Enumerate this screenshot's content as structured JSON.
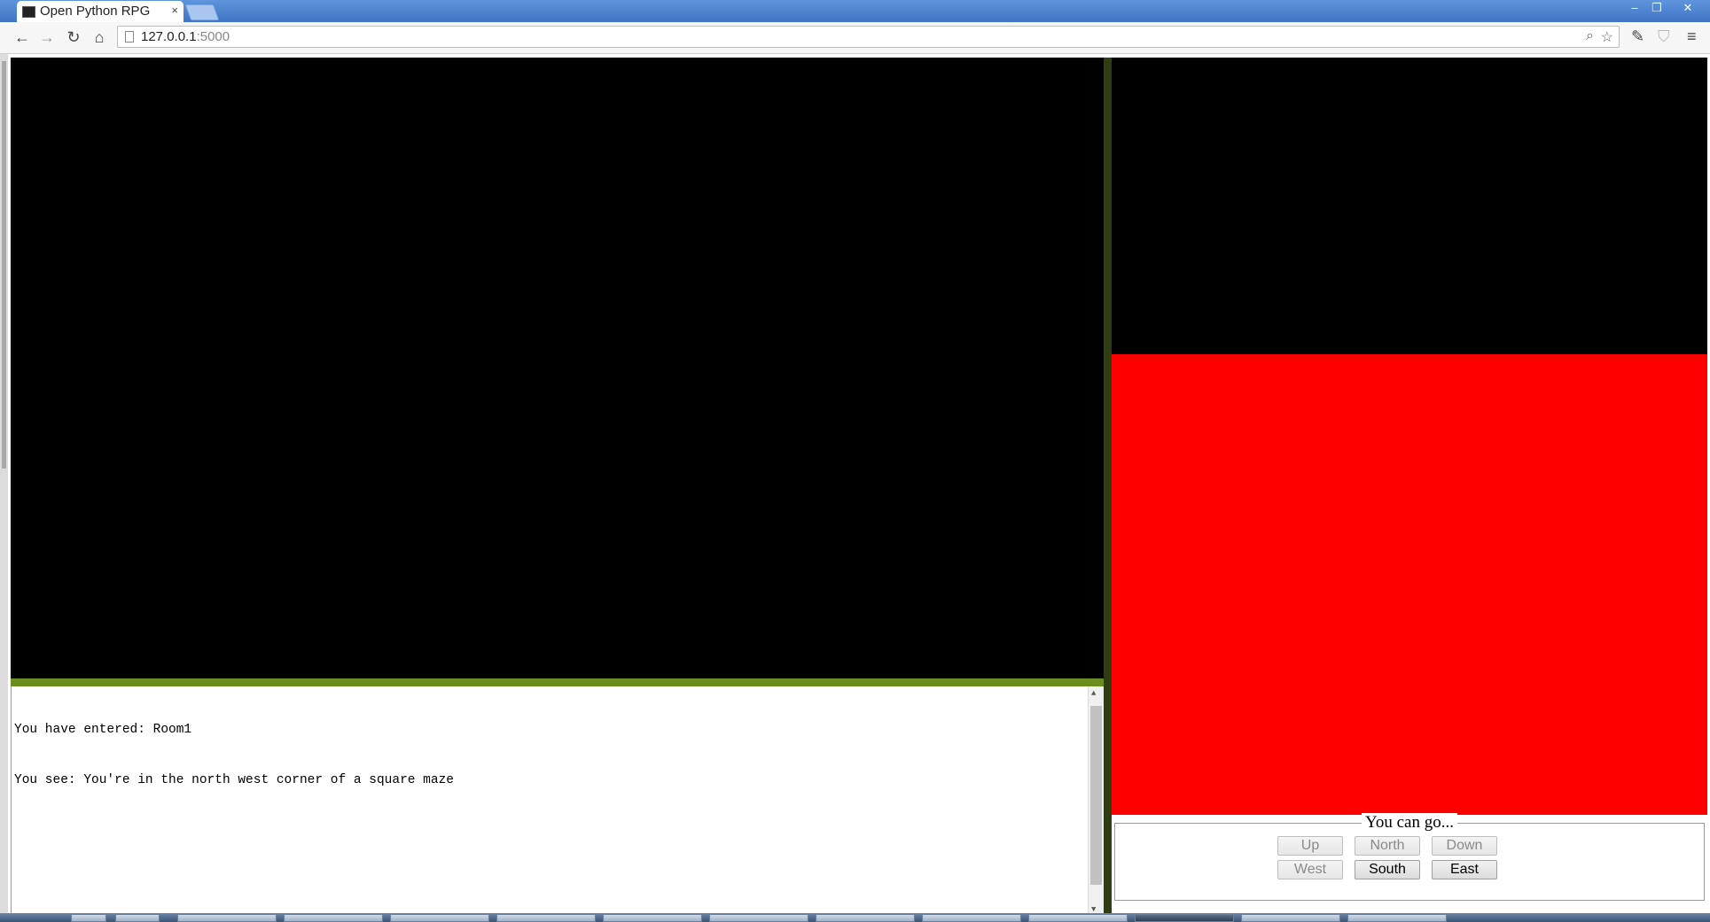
{
  "browser": {
    "tab_title": "Open Python RPG",
    "tab_close": "×",
    "url_host": "127.0.0.1",
    "url_port": ":5000",
    "window_controls": {
      "minimize": "–",
      "restore": "❐",
      "close": "✕"
    },
    "icons": {
      "back": "←",
      "forward": "→",
      "reload": "↻",
      "home": "⌂",
      "zoom": "⌕",
      "star": "☆",
      "extension": "✎",
      "shield": "⛉",
      "menu": "≡"
    }
  },
  "log": {
    "lines": [
      "You have entered: Room1",
      "You see: You're in the north west corner of a square maze"
    ],
    "scroll_up": "▲",
    "scroll_down": "▼"
  },
  "navigation": {
    "legend": "You can go...",
    "buttons": {
      "up": "Up",
      "north": "North",
      "down": "Down",
      "west": "West",
      "south": "South",
      "east": "East"
    },
    "enabled": [
      "South",
      "East"
    ]
  },
  "colors": {
    "game_view": "#000000",
    "room_tile": "#ff0000",
    "green_bar": "#6b8c1f",
    "divider": "#2f3d12"
  }
}
